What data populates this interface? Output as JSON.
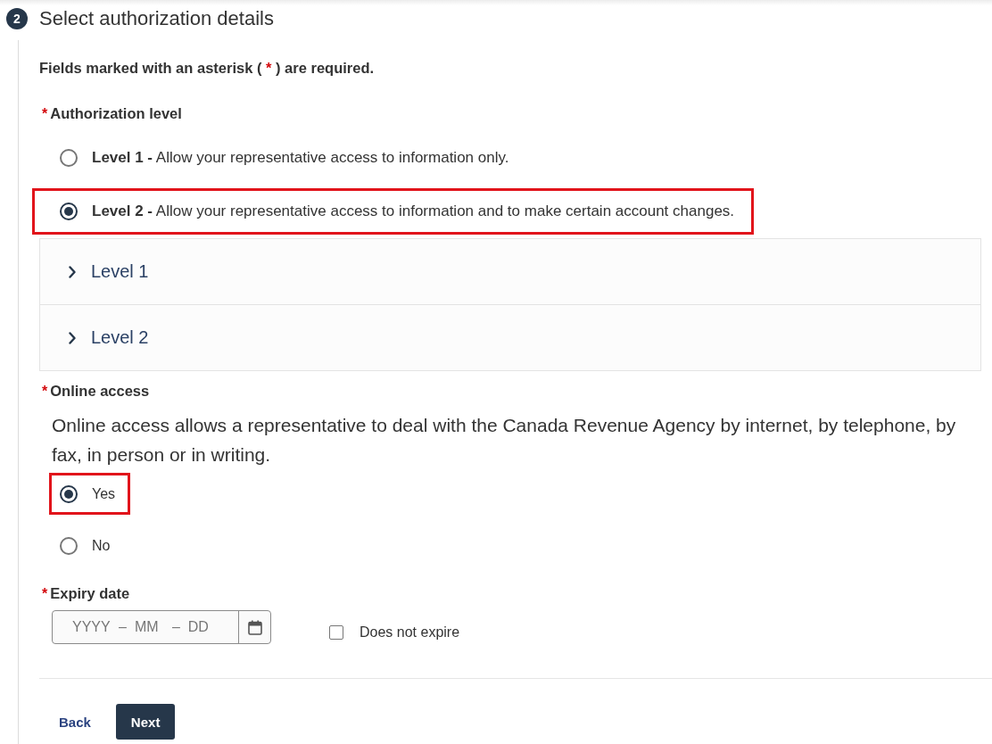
{
  "step": {
    "number": "2",
    "title": "Select authorization details"
  },
  "required_note": {
    "before": "Fields marked with an asterisk ( ",
    "asterisk": "*",
    "after": " ) are required."
  },
  "authorization_level": {
    "required_mark": "*",
    "label": "Authorization level",
    "options": [
      {
        "text": "**Level 1 -** Allow your representative access to information only.",
        "selected": false,
        "highlighted": false
      },
      {
        "text": "**Level 2 -** Allow your representative access to information and to make certain account changes.",
        "selected": true,
        "highlighted": true
      }
    ]
  },
  "level_details": [
    {
      "label": "Level 1",
      "expanded": false
    },
    {
      "label": "Level 2",
      "expanded": false
    }
  ],
  "online_access": {
    "required_mark": "*",
    "label": "Online access",
    "description": "Online access allows a representative to deal with the Canada Revenue Agency by internet, by telephone, by fax, in person or in writing.",
    "options": [
      {
        "label": "Yes",
        "selected": true,
        "highlighted": true
      },
      {
        "label": "No",
        "selected": false,
        "highlighted": false
      }
    ]
  },
  "expiry_date": {
    "required_mark": "*",
    "label": "Expiry date",
    "date_field": {
      "year": {
        "placeholder": "YYYY"
      },
      "separator_1": "–",
      "month": {
        "placeholder": "MM"
      },
      "separator_2": "–",
      "day": {
        "placeholder": "DD"
      }
    },
    "does_not_expire": {
      "label": "Does not expire",
      "checked": false
    }
  },
  "actions": [
    {
      "label": "Back",
      "kind": "link"
    },
    {
      "label": "Next",
      "kind": "primary"
    }
  ]
}
